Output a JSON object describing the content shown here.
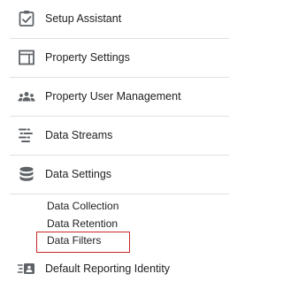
{
  "nav": {
    "setup_assistant": {
      "label": "Setup Assistant",
      "icon": "checkbox-list-icon"
    },
    "property_settings": {
      "label": "Property Settings",
      "icon": "property-window-icon"
    },
    "property_user_management": {
      "label": "Property User Management",
      "icon": "people-group-icon"
    },
    "data_streams": {
      "label": "Data Streams",
      "icon": "streams-icon"
    },
    "data_settings": {
      "label": "Data Settings",
      "icon": "database-icon"
    },
    "data_settings_children": [
      {
        "label": "Data Collection"
      },
      {
        "label": "Data Retention"
      },
      {
        "label": "Data Filters"
      }
    ],
    "default_reporting_identity": {
      "label": "Default Reporting Identity",
      "icon": "reporting-identity-icon"
    }
  },
  "colors": {
    "icon": "#5f6368",
    "text": "#202124",
    "divider": "#e0e0e0",
    "highlight": "#c62828"
  }
}
